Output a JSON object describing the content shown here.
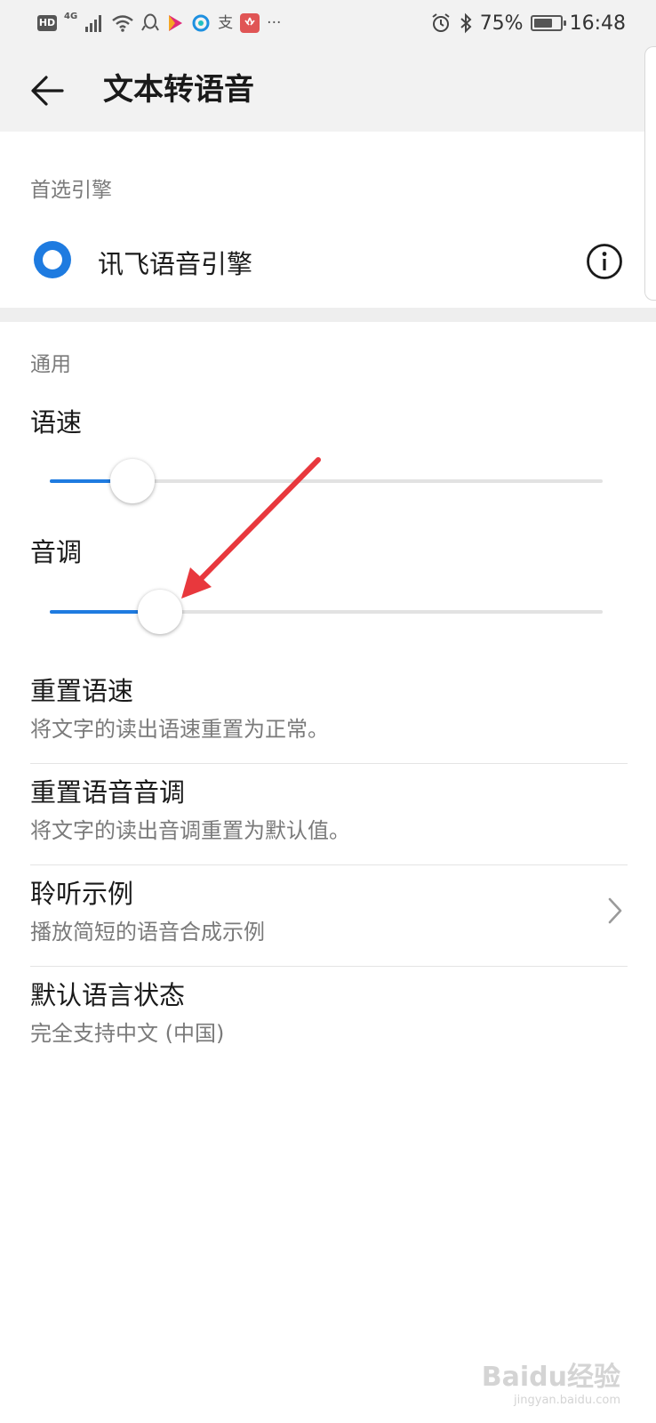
{
  "status_bar": {
    "hd": "HD",
    "network": "4G",
    "battery_percent": "75%",
    "battery_level": 0.75,
    "time": "16:48",
    "icons": [
      "signal-icon",
      "wifi-icon",
      "qq-icon",
      "video-app-icon",
      "browser-icon",
      "alipay-icon",
      "huawei-icon",
      "more-notifications-icon",
      "alarm-icon",
      "bluetooth-icon",
      "battery-icon"
    ]
  },
  "toolbar": {
    "back_icon": "arrow-left-icon",
    "title": "文本转语音"
  },
  "preferred_engine": {
    "section_label": "首选引擎",
    "engine_name": "讯飞语音引擎",
    "selected": true,
    "info_icon": "info-icon"
  },
  "general": {
    "section_label": "通用",
    "speech_rate": {
      "label": "语速",
      "value": 0.15
    },
    "pitch": {
      "label": "音调",
      "value": 0.2
    }
  },
  "items": [
    {
      "title": "重置语速",
      "subtitle": "将文字的读出语速重置为正常。"
    },
    {
      "title": "重置语音音调",
      "subtitle": "将文字的读出音调重置为默认值。"
    },
    {
      "title": "聆听示例",
      "subtitle": "播放简短的语音合成示例",
      "chevron": "chevron-right-icon"
    },
    {
      "title": "默认语言状态",
      "subtitle": "完全支持中文 (中国)"
    }
  ],
  "annotation": {
    "color": "#e8383d",
    "icon": "annotation-arrow"
  },
  "watermark": {
    "text": "Baidu经验",
    "sub": "jingyan.baidu.com"
  },
  "colors": {
    "accent": "#1e7be0",
    "bar_bg": "#f2f2f2"
  }
}
